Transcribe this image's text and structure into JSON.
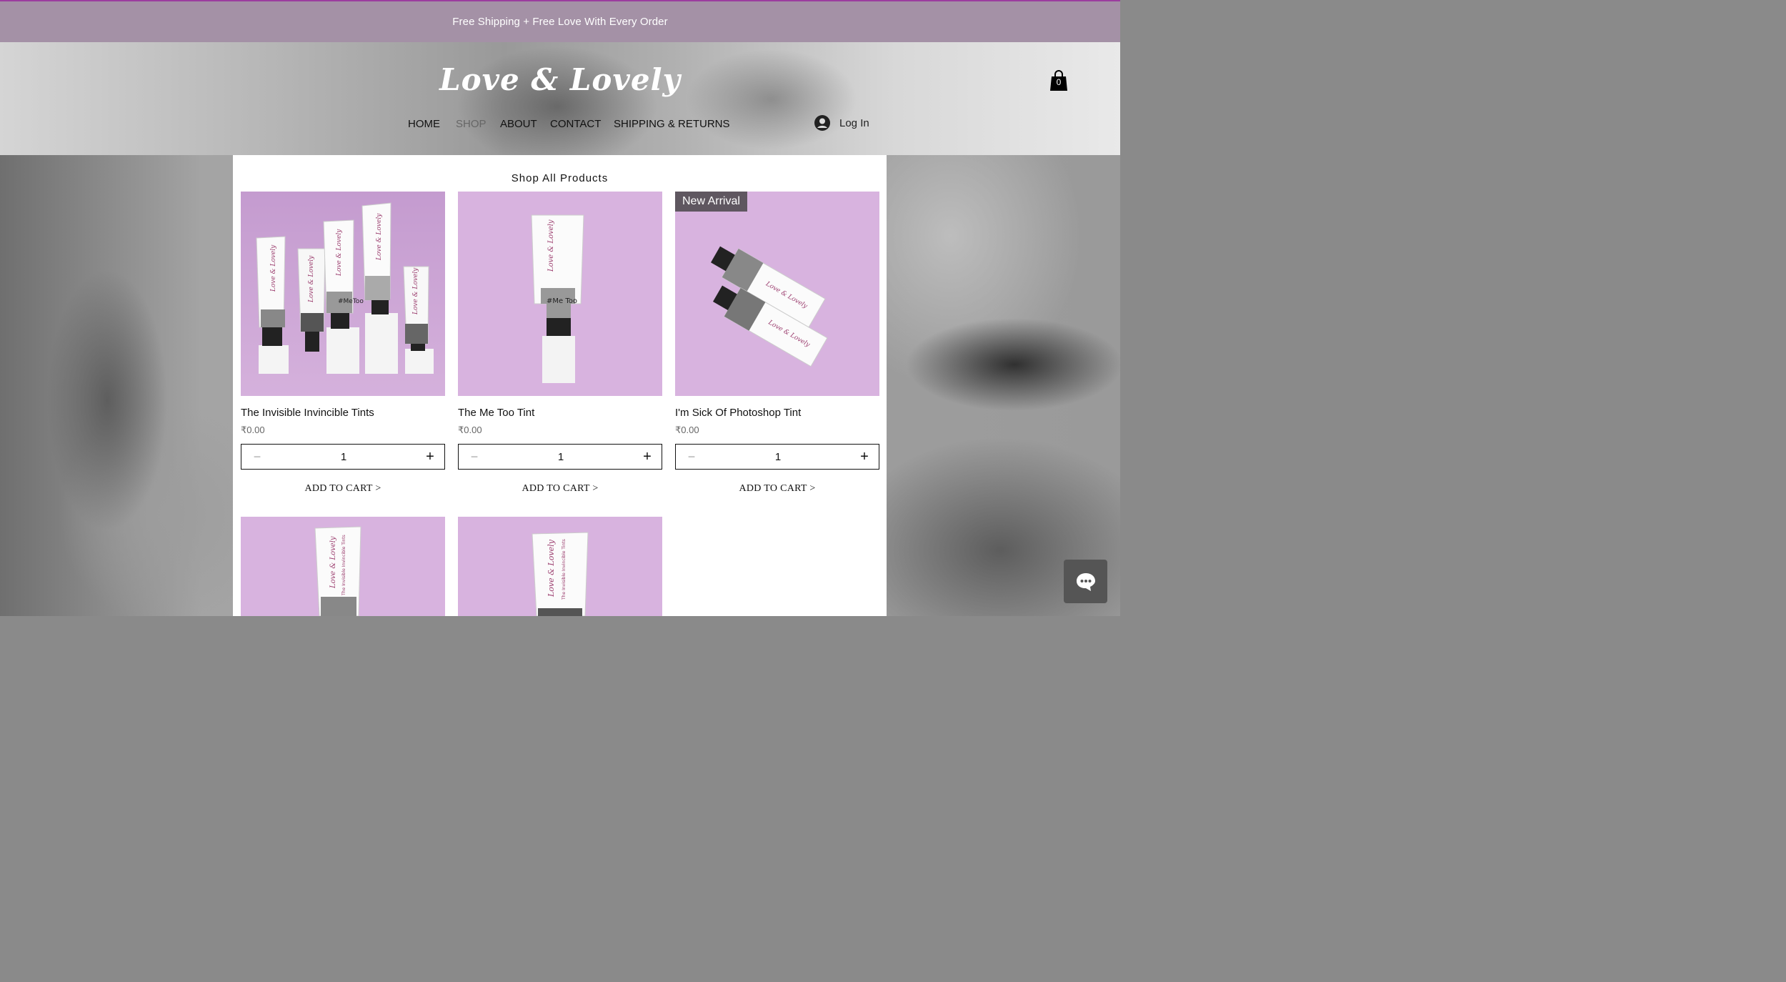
{
  "promo": {
    "text": "Free Shipping + Free Love With Every Order"
  },
  "header": {
    "logo": "Love & Lovely",
    "cart_count": "0",
    "login_label": "Log In"
  },
  "nav": [
    {
      "label": "HOME"
    },
    {
      "label": "SHOP",
      "active": true
    },
    {
      "label": "ABOUT"
    },
    {
      "label": "CONTACT"
    },
    {
      "label": "SHIPPING & RETURNS"
    }
  ],
  "shop": {
    "title": "Shop All Products",
    "products": [
      {
        "name": "The Invisible Invincible Tints",
        "price": "₹0.00",
        "quantity": "1",
        "add_label": "ADD TO CART >"
      },
      {
        "name": "The Me Too Tint",
        "price": "₹0.00",
        "quantity": "1",
        "add_label": "ADD TO CART >"
      },
      {
        "name": "I'm Sick Of Photoshop Tint",
        "price": "₹0.00",
        "quantity": "1",
        "add_label": "ADD TO CART >",
        "badge": "New Arrival"
      }
    ],
    "tube_label": "Love & Lovely",
    "tube_sub": "The Invisible Invincible Tints",
    "tube_tag": "#MeToo",
    "tube_tag_small": "#Me Too"
  },
  "colors": {
    "promo_bg": "#a491a6",
    "card_bg": "#d8b3df",
    "badge_bg": "#5f5760",
    "brand": "#9b3d9e"
  },
  "icons": {
    "cart": "shopping-bag-icon",
    "user": "user-avatar-icon",
    "chat": "chat-bubble-icon",
    "minus": "minus-icon",
    "plus": "plus-icon"
  }
}
